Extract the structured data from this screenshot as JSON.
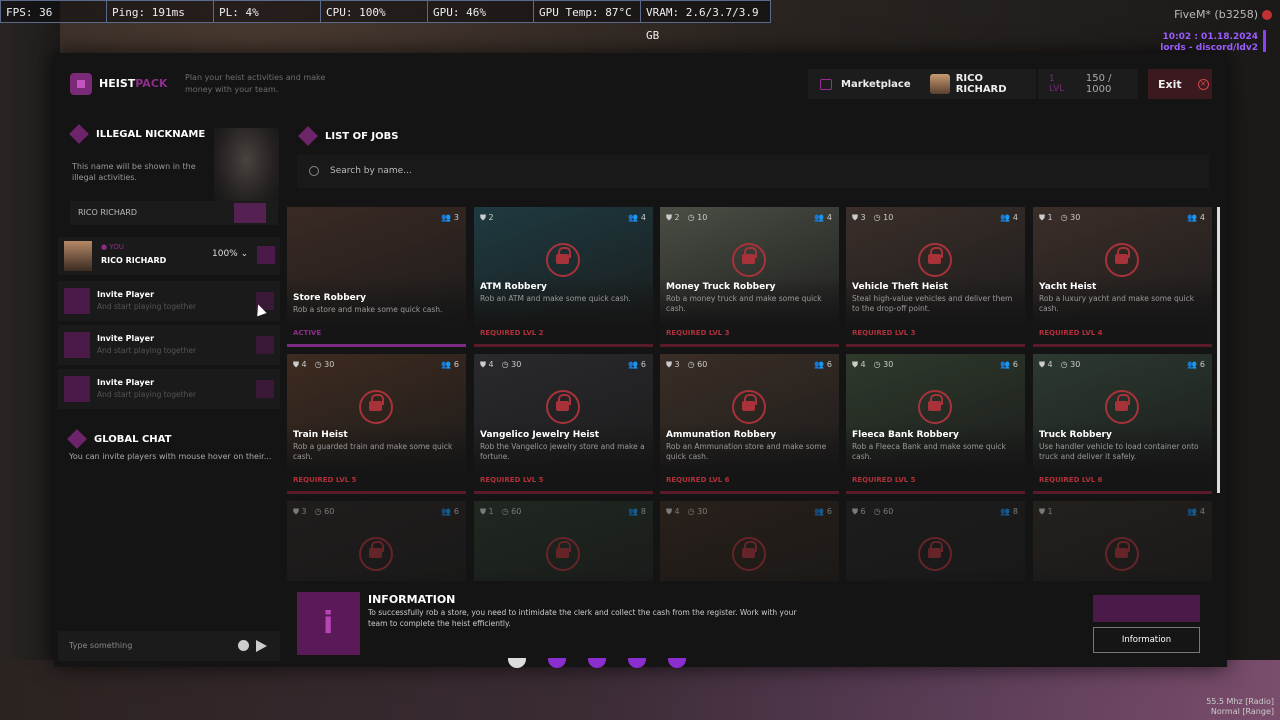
{
  "overlay": {
    "fps": "FPS: 36",
    "ping": "Ping: 191ms",
    "pl": "PL: 4%",
    "cpu": "CPU: 100%",
    "gpu": "GPU: 46%",
    "gpu_temp": "GPU Temp: 87°C",
    "vram": "VRAM: 2.6/3.7/3.9 GB",
    "fivem": "FiveM* (b3258)",
    "time": "10:02 : 01.18.2024",
    "server": "lords - discord/ldv2",
    "radio_freq": "55.5 Mhz [Radio]",
    "radio_mode": "Normal [Range]"
  },
  "header": {
    "logo_a": "HEIST",
    "logo_b": "PACK",
    "tagline": "Plan your heist activities and make money with your team.",
    "marketplace": "Marketplace",
    "user": "RICO RICHARD",
    "level_label": "1 LVL",
    "xp": "150 / 1000",
    "exit": "Exit"
  },
  "nickname": {
    "title": "ILLEGAL NICKNAME",
    "desc": "This name will be shown in the illegal activities.",
    "value": "RICO RICHARD"
  },
  "party": {
    "me": {
      "tag": "● YOU",
      "name": "RICO RICHARD",
      "percent": "100%"
    },
    "invites": [
      {
        "title": "Invite Player",
        "sub": "And start playing together"
      },
      {
        "title": "Invite Player",
        "sub": "And start playing together"
      },
      {
        "title": "Invite Player",
        "sub": "And start playing together"
      }
    ]
  },
  "chat": {
    "title": "GLOBAL CHAT",
    "desc": "You can invite players with mouse hover on their...",
    "placeholder": "Type something"
  },
  "jobs": {
    "title": "LIST OF JOBS",
    "search_placeholder": "Search by name...",
    "cards": [
      {
        "title": "Store Robbery",
        "desc": "Rob a store and make some quick cash.",
        "status": "ACTIVE",
        "level": "",
        "time": "",
        "players": "3",
        "color": "#3a2a24"
      },
      {
        "title": "ATM Robbery",
        "desc": "Rob an ATM and make some quick cash.",
        "status": "REQUIRED LVL 2",
        "level": "2",
        "time": "",
        "players": "4",
        "color": "#1e3a40"
      },
      {
        "title": "Money Truck Robbery",
        "desc": "Rob a money truck and make some quick cash.",
        "status": "REQUIRED LVL 3",
        "level": "2",
        "time": "10",
        "players": "4",
        "color": "#4a4e44"
      },
      {
        "title": "Vehicle Theft Heist",
        "desc": "Steal high-value vehicles and deliver them to the drop-off point.",
        "status": "REQUIRED LVL 3",
        "level": "3",
        "time": "10",
        "players": "4",
        "color": "#3a2f2a"
      },
      {
        "title": "Yacht Heist",
        "desc": "Rob a luxury yacht and make some quick cash.",
        "status": "REQUIRED LVL 4",
        "level": "1",
        "time": "30",
        "players": "4",
        "color": "#3b2e29"
      },
      {
        "title": "Train Heist",
        "desc": "Rob a guarded train and make some quick cash.",
        "status": "REQUIRED LVL 5",
        "level": "4",
        "time": "30",
        "players": "6",
        "color": "#3e2b20"
      },
      {
        "title": "Vangelico Jewelry Heist",
        "desc": "Rob the Vangelico jewelry store and make a fortune.",
        "status": "REQUIRED LVL 5",
        "level": "4",
        "time": "30",
        "players": "6",
        "color": "#2a2a2e"
      },
      {
        "title": "Ammunation Robbery",
        "desc": "Rob an Ammunation store and make some quick cash.",
        "status": "REQUIRED LVL 6",
        "level": "3",
        "time": "60",
        "players": "6",
        "color": "#3a2e26"
      },
      {
        "title": "Fleeca Bank Robbery",
        "desc": "Rob a Fleeca Bank and make some quick cash.",
        "status": "REQUIRED LVL 5",
        "level": "4",
        "time": "30",
        "players": "6",
        "color": "#2e3a2c"
      },
      {
        "title": "Truck Robbery",
        "desc": "Use handler vehicle to load container onto truck and deliver it safely.",
        "status": "REQUIRED LVL 6",
        "level": "4",
        "time": "30",
        "players": "6",
        "color": "#2c3a30"
      },
      {
        "title": "",
        "desc": "",
        "status": "",
        "level": "3",
        "time": "60",
        "players": "6",
        "color": "#2a2624"
      },
      {
        "title": "",
        "desc": "",
        "status": "",
        "level": "1",
        "time": "60",
        "players": "8",
        "color": "#2a3a2c"
      },
      {
        "title": "",
        "desc": "",
        "status": "",
        "level": "4",
        "time": "30",
        "players": "6",
        "color": "#3a2a20"
      },
      {
        "title": "",
        "desc": "",
        "status": "",
        "level": "6",
        "time": "60",
        "players": "8",
        "color": "#242424"
      },
      {
        "title": "",
        "desc": "",
        "status": "",
        "level": "1",
        "time": "",
        "players": "4",
        "color": "#302a24"
      }
    ]
  },
  "info": {
    "title": "INFORMATION",
    "desc": "To successfully rob a store, you need to intimidate the clerk and collect the cash from the register. Work with your team to complete the heist efficiently.",
    "button": "Information"
  },
  "colors": {
    "accent": "#8e2c8c",
    "danger": "#b0303a"
  }
}
